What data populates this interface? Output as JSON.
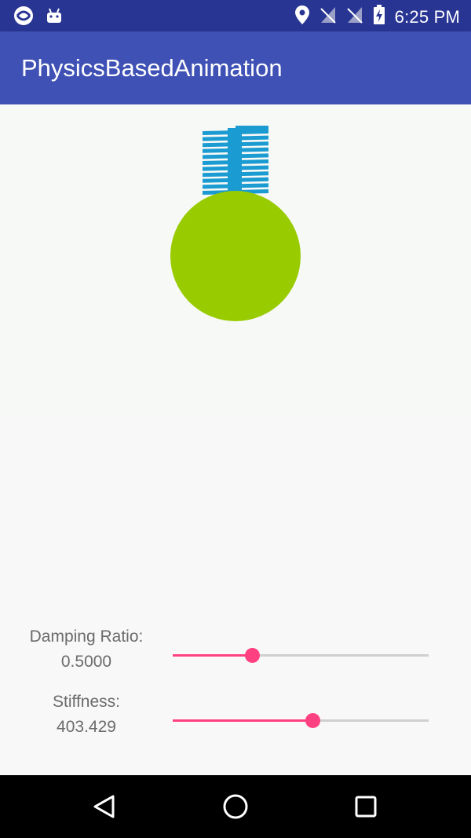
{
  "status_bar": {
    "time": "6:25 PM",
    "left_icons": [
      "sync-icon",
      "android-icon"
    ],
    "right_icons": [
      "location-icon",
      "signal-off-icon",
      "signal-off-icon",
      "battery-charging-icon"
    ]
  },
  "app_bar": {
    "title": "PhysicsBasedAnimation"
  },
  "controls": {
    "damping": {
      "label": "Damping Ratio:",
      "value": "0.5000",
      "fraction": 0.31
    },
    "stiffness": {
      "label": "Stiffness:",
      "value": "403.429",
      "fraction": 0.545
    }
  },
  "nav_bar": {
    "icons": [
      "back-icon",
      "home-icon",
      "recents-icon"
    ]
  },
  "colors": {
    "status_bar": "#283593",
    "app_bar": "#3f51b5",
    "spring": "#1a9bd1",
    "ball": "#99cc00",
    "accent": "#ff4081"
  }
}
